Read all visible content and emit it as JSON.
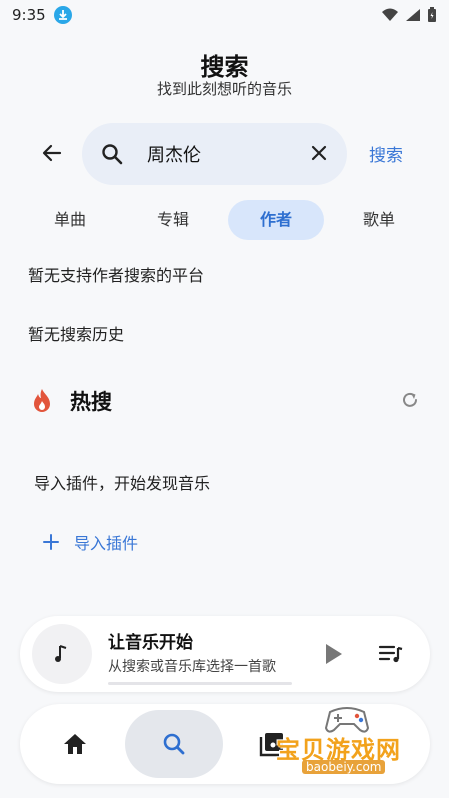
{
  "status_bar": {
    "time": "9:35"
  },
  "header": {
    "title": "搜索",
    "subtitle": "找到此刻想听的音乐"
  },
  "search": {
    "value": "周杰伦",
    "action_label": "搜索"
  },
  "tabs": [
    {
      "label": "单曲"
    },
    {
      "label": "专辑"
    },
    {
      "label": "作者",
      "active": true
    },
    {
      "label": "歌单"
    }
  ],
  "notices": {
    "no_platform": "暂无支持作者搜索的平台",
    "no_history": "暂无搜索历史"
  },
  "hot": {
    "title": "热搜",
    "empty_text": "导入插件，开始发现音乐",
    "import_label": "导入插件"
  },
  "player": {
    "title": "让音乐开始",
    "subtitle": "从搜索或音乐库选择一首歌"
  },
  "watermark": {
    "text": "宝贝游戏网",
    "url": "baobeiy.com"
  },
  "colors": {
    "accent": "#3a77d6",
    "tab_active_bg": "#d8e6fb",
    "search_bg": "#e9eef7",
    "fire": "#e2553c"
  }
}
